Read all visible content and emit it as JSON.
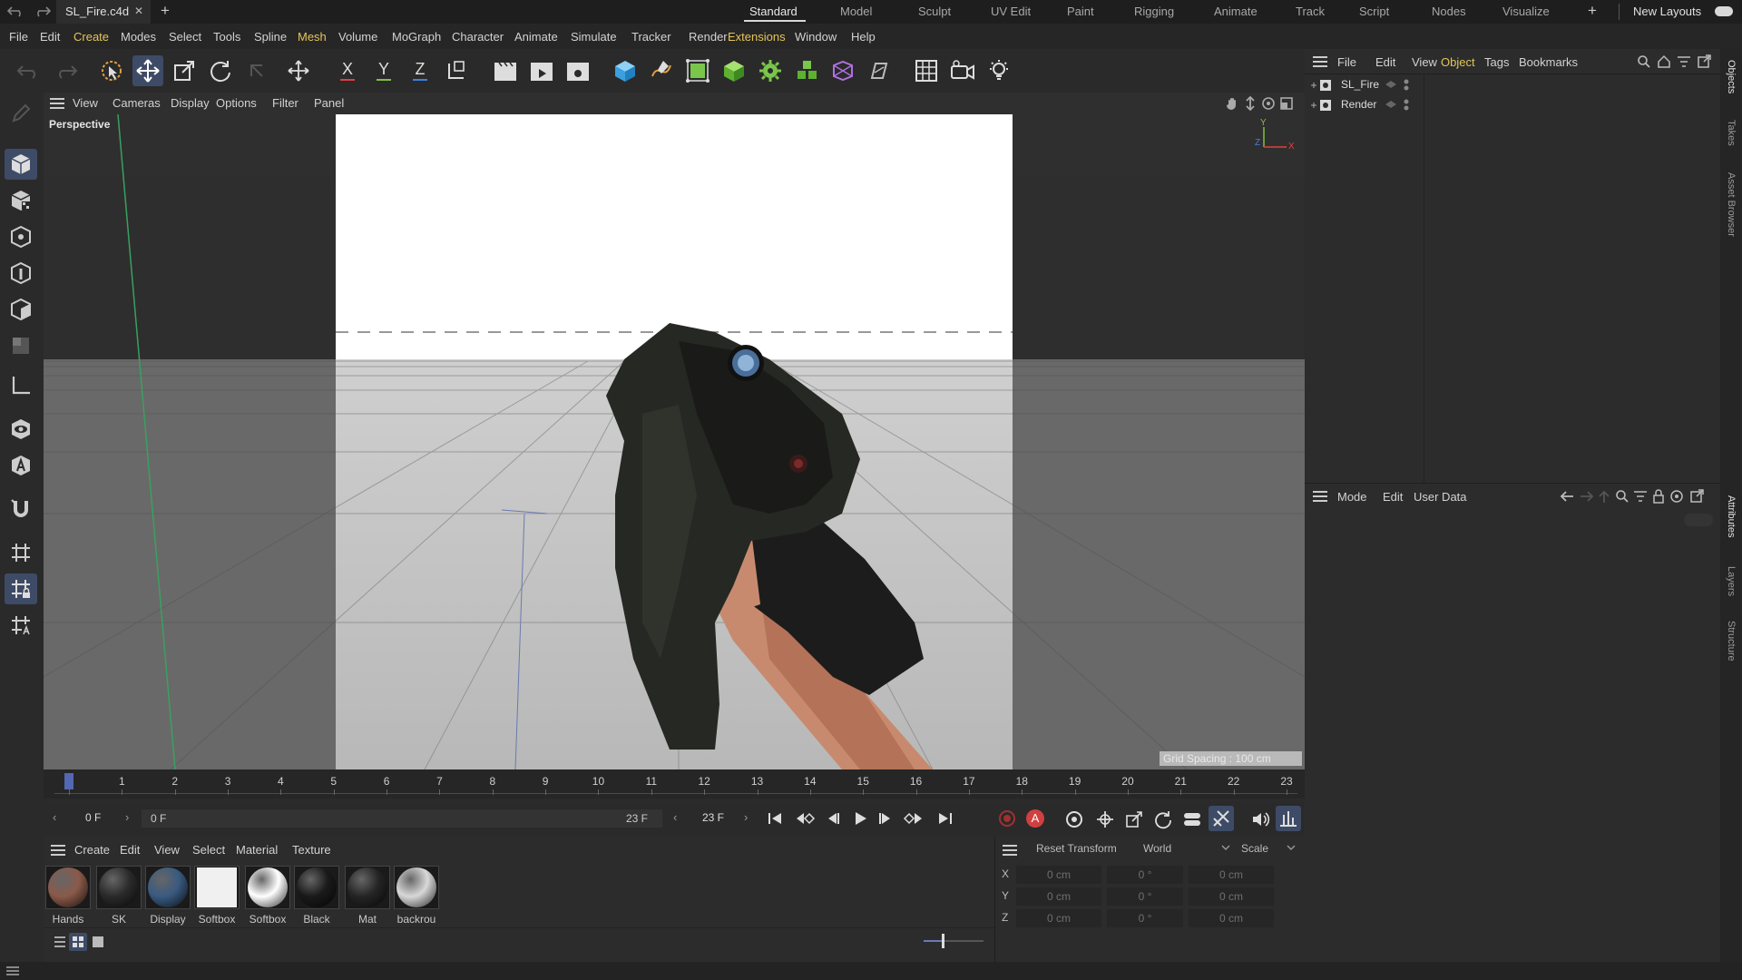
{
  "titlebar": {
    "filename": "SL_Fire.c4d",
    "close": "✕",
    "add": "+",
    "layouts": [
      "Standard",
      "Model",
      "Sculpt",
      "UV Edit",
      "Paint",
      "Rigging",
      "Animate",
      "Track",
      "Script",
      "Nodes",
      "Visualize"
    ],
    "new_layouts": "New Layouts"
  },
  "menus": [
    "File",
    "Edit",
    "Create",
    "Modes",
    "Select",
    "Tools",
    "Spline",
    "Mesh",
    "Volume",
    "MoGraph",
    "Character",
    "Animate",
    "Simulate",
    "Tracker",
    "Render",
    "Extensions",
    "Window",
    "Help"
  ],
  "toolbar": {
    "axis_x": "X",
    "axis_y": "Y",
    "axis_z": "Z"
  },
  "viewport": {
    "menu": [
      "View",
      "Cameras",
      "Display",
      "Options",
      "Filter",
      "Panel"
    ],
    "label": "Perspective",
    "grid_spacing": "Grid Spacing : 100 cm",
    "axis_y": "Y",
    "axis_z": "Z",
    "axis_x": "X"
  },
  "timeline": {
    "ticks": [
      "0",
      "1",
      "2",
      "3",
      "4",
      "5",
      "6",
      "7",
      "8",
      "9",
      "10",
      "11",
      "12",
      "13",
      "14",
      "15",
      "16",
      "17",
      "18",
      "19",
      "20",
      "21",
      "22",
      "23"
    ],
    "current": 0,
    "total": 23
  },
  "transport": {
    "current_frame": "0 F",
    "range_start": "0 F",
    "range_end": "23 F",
    "end_frame": "23 F",
    "autokey": "A"
  },
  "materials": {
    "menu": [
      "Create",
      "Edit",
      "View",
      "Select",
      "Material",
      "Texture"
    ],
    "items": [
      {
        "name": "Hands",
        "color": "#8a5a4a"
      },
      {
        "name": "SK",
        "color": "#2a2a2a"
      },
      {
        "name": "Display",
        "color": "#3a5a80"
      },
      {
        "name": "Softbox",
        "color": "#f0f0f0"
      },
      {
        "name": "Softbox",
        "color": "#ffffff"
      },
      {
        "name": "Black",
        "color": "#1a1a1a"
      },
      {
        "name": "Mat",
        "color": "#252525"
      },
      {
        "name": "backrou",
        "color": "#d8d8d8"
      }
    ]
  },
  "coords": {
    "reset": "Reset Transform",
    "space": "World",
    "mode": "Scale",
    "rows": [
      {
        "axis": "X",
        "pos": "0 cm",
        "rot": "0 °",
        "scale": "0 cm"
      },
      {
        "axis": "Y",
        "pos": "0 cm",
        "rot": "0 °",
        "scale": "0 cm"
      },
      {
        "axis": "Z",
        "pos": "0 cm",
        "rot": "0 °",
        "scale": "0 cm"
      }
    ]
  },
  "objects": {
    "menu": [
      "File",
      "Edit",
      "View",
      "Object",
      "Tags",
      "Bookmarks"
    ],
    "items": [
      "SL_Fire",
      "Render"
    ]
  },
  "attributes": {
    "menu": [
      "Mode",
      "Edit",
      "User Data"
    ]
  },
  "side_tabs": [
    "Objects",
    "Takes",
    "Asset Browser",
    "Attributes",
    "Layers",
    "Structure"
  ]
}
